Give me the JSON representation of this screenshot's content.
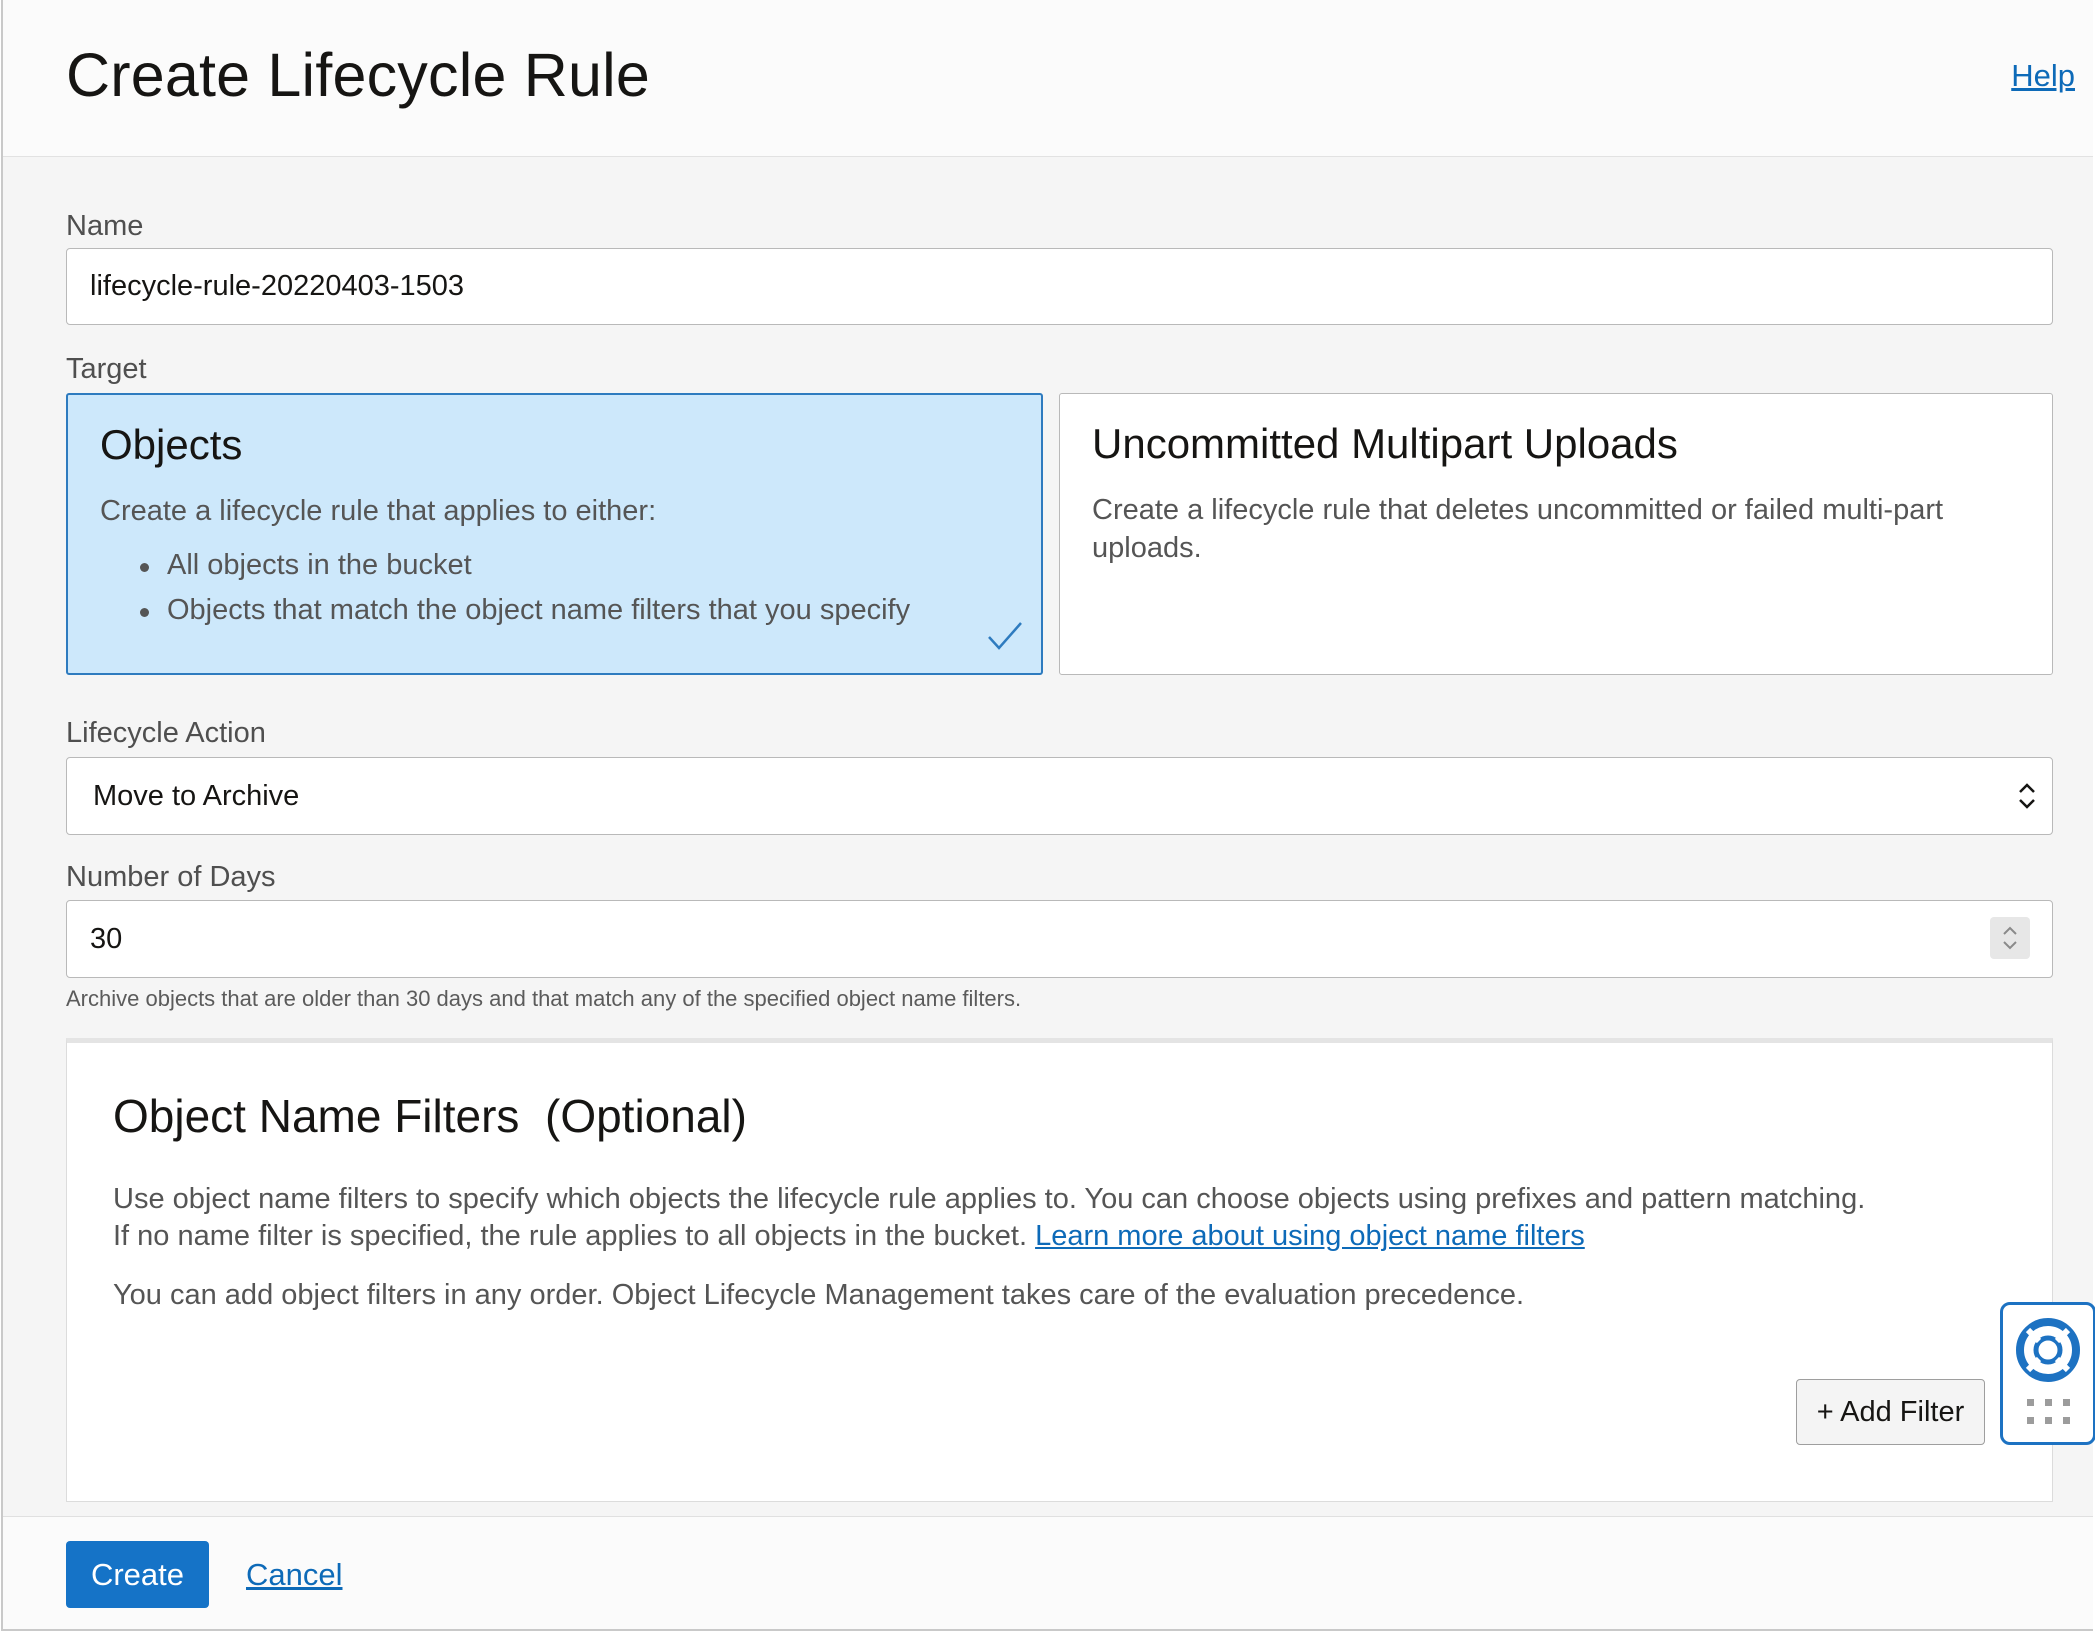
{
  "header": {
    "title": "Create Lifecycle Rule",
    "help_label": "Help"
  },
  "name_field": {
    "label": "Name",
    "value": "lifecycle-rule-20220403-1503"
  },
  "target": {
    "label": "Target",
    "options": [
      {
        "title": "Objects",
        "description": "Create a lifecycle rule that applies to either:",
        "bullets": [
          "All objects in the bucket",
          "Objects that match the object name filters that you specify"
        ],
        "selected": true
      },
      {
        "title": "Uncommitted Multipart Uploads",
        "description": "Create a lifecycle rule that deletes uncommitted or failed multi-part uploads.",
        "selected": false
      }
    ]
  },
  "lifecycle_action": {
    "label": "Lifecycle Action",
    "selected": "Move to Archive"
  },
  "days": {
    "label": "Number of Days",
    "value": "30",
    "helper": "Archive objects that are older than 30 days and that match any of the specified object name filters."
  },
  "filters": {
    "title": "Object Name Filters",
    "optional": "(Optional)",
    "text1": "Use object name filters to specify which objects the lifecycle rule applies to. You can choose objects using prefixes and pattern matching.",
    "text2": "If no name filter is specified, the rule applies to all objects in the bucket.",
    "learn_link": "Learn more about using object name filters",
    "text3": "You can add object filters in any order. Object Lifecycle Management takes care of the evaluation precedence.",
    "add_button": "+ Add Filter"
  },
  "footer": {
    "create_label": "Create",
    "cancel_label": "Cancel"
  },
  "colors": {
    "primary": "#1573c7",
    "link": "#0d6ab8",
    "selected_tile": "#cde8fb"
  },
  "icons": [
    "check-icon",
    "chevron-up-down-icon",
    "lifebuoy-icon",
    "grid-icon"
  ]
}
